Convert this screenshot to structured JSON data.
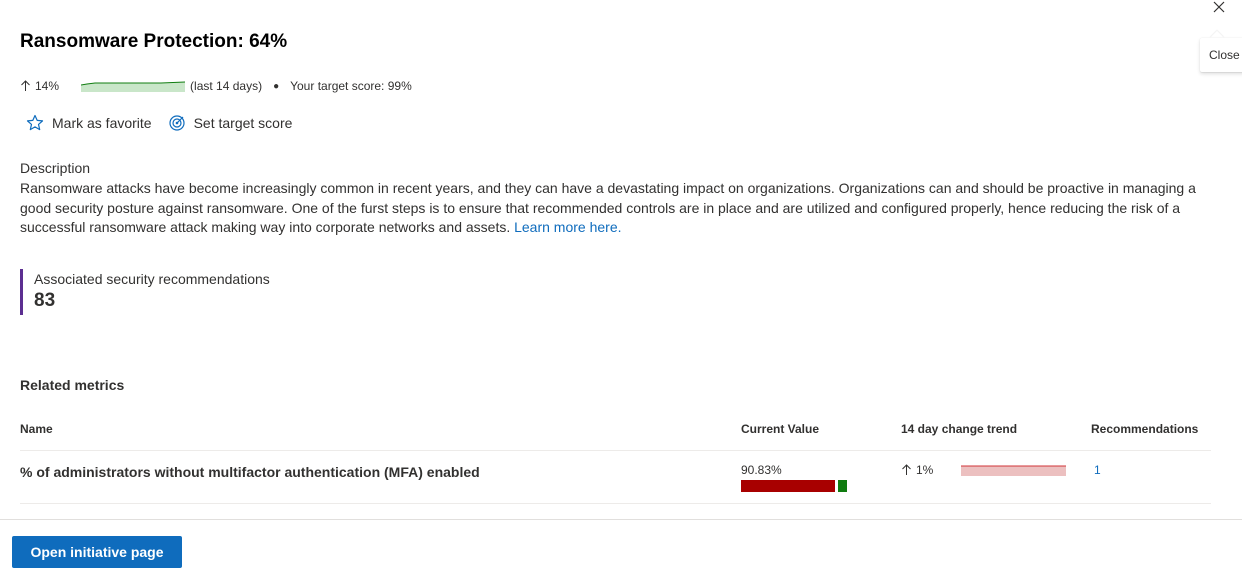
{
  "panel": {
    "title": "Ransomware Protection: 64%",
    "close_tooltip": "Close"
  },
  "score": {
    "change": "14%",
    "period": "(last 14 days)",
    "target": "Your target score: 99%",
    "trend_color": "#107c10"
  },
  "actions": {
    "favorite": "Mark as favorite",
    "target_score": "Set target score"
  },
  "description": {
    "heading": "Description",
    "text": "Ransomware attacks have become increasingly common in recent years, and they can have a devastating impact on organizations. Organizations can and should be proactive in managing a good security posture against ransomware. One of the furst steps is to ensure that recommended controls are in place and are utilized and configured properly, hence reducing the risk of a successful ransomware attack making way into corporate networks and assets.",
    "link": "Learn more here."
  },
  "associated": {
    "label": "Associated security recommendations",
    "count": "83",
    "accent": "#5c2e91"
  },
  "related_metrics": {
    "heading": "Related metrics",
    "columns": [
      "Name",
      "Current Value",
      "14 day change trend",
      "Recommendations"
    ],
    "rows": [
      {
        "name": "% of administrators without multifactor authentication (MFA) enabled",
        "current_value": "90.83%",
        "current_fraction": 0.9083,
        "trend": "1%",
        "recommendations": "1"
      }
    ]
  },
  "footer": {
    "primary_button": "Open initiative page"
  },
  "colors": {
    "accent": "#0f6cbd",
    "bad": "#a80000",
    "good": "#107c10"
  }
}
